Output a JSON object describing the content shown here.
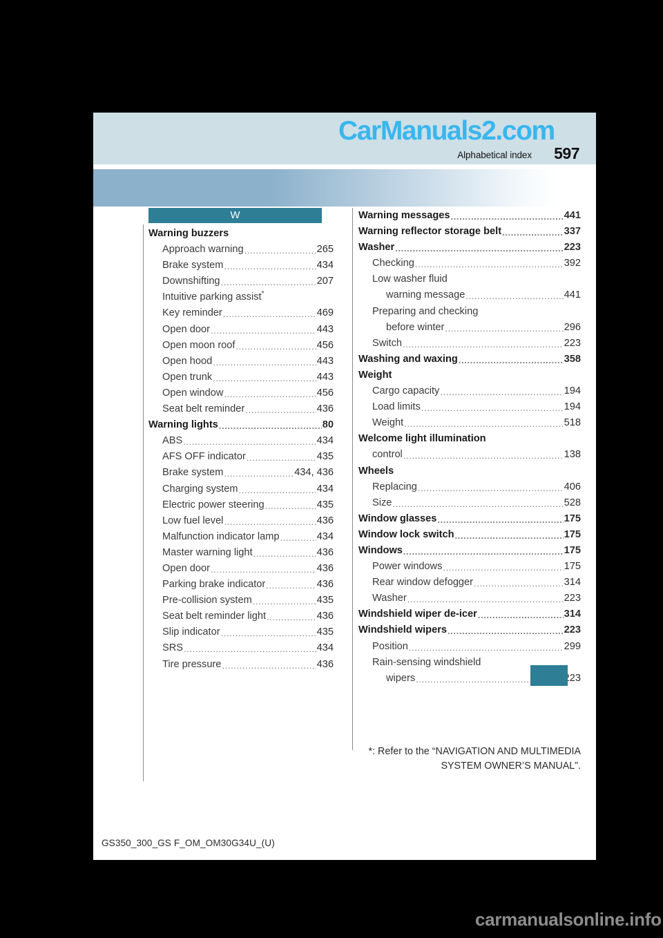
{
  "header": {
    "title": "Alphabetical index",
    "page_number": "597",
    "watermark": "CarManuals2.com"
  },
  "letter_section": "W",
  "left_column": [
    {
      "label": "Warning buzzers",
      "page": "",
      "level": 0,
      "leader": false
    },
    {
      "label": "Approach warning",
      "page": "265",
      "level": 1,
      "leader": true
    },
    {
      "label": "Brake system",
      "page": "434",
      "level": 1,
      "leader": true
    },
    {
      "label": "Downshifting",
      "page": "207",
      "level": 1,
      "leader": true
    },
    {
      "label": "Intuitive parking assist",
      "page": "",
      "level": 1,
      "leader": false,
      "superscript": "*"
    },
    {
      "label": "Key reminder",
      "page": "469",
      "level": 1,
      "leader": true
    },
    {
      "label": "Open door",
      "page": "443",
      "level": 1,
      "leader": true
    },
    {
      "label": "Open moon roof",
      "page": "456",
      "level": 1,
      "leader": true
    },
    {
      "label": "Open hood",
      "page": "443",
      "level": 1,
      "leader": true
    },
    {
      "label": "Open trunk",
      "page": "443",
      "level": 1,
      "leader": true
    },
    {
      "label": "Open window",
      "page": "456",
      "level": 1,
      "leader": true
    },
    {
      "label": "Seat belt reminder",
      "page": "436",
      "level": 1,
      "leader": true
    },
    {
      "label": "Warning lights",
      "page": "80",
      "level": 0,
      "leader": true
    },
    {
      "label": "ABS",
      "page": "434",
      "level": 1,
      "leader": true
    },
    {
      "label": "AFS OFF indicator",
      "page": "435",
      "level": 1,
      "leader": true
    },
    {
      "label": "Brake system",
      "page": "434, 436",
      "level": 1,
      "leader": true
    },
    {
      "label": "Charging system",
      "page": "434",
      "level": 1,
      "leader": true
    },
    {
      "label": "Electric power steering",
      "page": "435",
      "level": 1,
      "leader": true
    },
    {
      "label": "Low fuel level",
      "page": "436",
      "level": 1,
      "leader": true
    },
    {
      "label": "Malfunction indicator lamp",
      "page": "434",
      "level": 1,
      "leader": true
    },
    {
      "label": "Master warning light",
      "page": "436",
      "level": 1,
      "leader": true
    },
    {
      "label": "Open door",
      "page": "436",
      "level": 1,
      "leader": true
    },
    {
      "label": "Parking brake indicator",
      "page": "436",
      "level": 1,
      "leader": true
    },
    {
      "label": "Pre-collision system",
      "page": "435",
      "level": 1,
      "leader": true
    },
    {
      "label": "Seat belt reminder light",
      "page": "436",
      "level": 1,
      "leader": true
    },
    {
      "label": "Slip indicator",
      "page": "435",
      "level": 1,
      "leader": true
    },
    {
      "label": "SRS",
      "page": "434",
      "level": 1,
      "leader": true
    },
    {
      "label": "Tire pressure",
      "page": "436",
      "level": 1,
      "leader": true
    }
  ],
  "right_column": [
    {
      "label": "Warning messages",
      "page": "441",
      "level": 0,
      "leader": true
    },
    {
      "label": "Warning reflector storage belt",
      "page": "337",
      "level": 0,
      "leader": true
    },
    {
      "label": "Washer",
      "page": "223",
      "level": 0,
      "leader": true
    },
    {
      "label": "Checking",
      "page": "392",
      "level": 1,
      "leader": true
    },
    {
      "label": "Low washer fluid",
      "page": "",
      "level": 1,
      "leader": false
    },
    {
      "label": "warning message",
      "page": "441",
      "level": 2,
      "leader": true
    },
    {
      "label": "Preparing and checking",
      "page": "",
      "level": 1,
      "leader": false
    },
    {
      "label": "before winter",
      "page": "296",
      "level": 2,
      "leader": true
    },
    {
      "label": "Switch",
      "page": "223",
      "level": 1,
      "leader": true
    },
    {
      "label": "Washing and waxing",
      "page": "358",
      "level": 0,
      "leader": true
    },
    {
      "label": "Weight",
      "page": "",
      "level": 0,
      "leader": false
    },
    {
      "label": "Cargo capacity",
      "page": "194",
      "level": 1,
      "leader": true
    },
    {
      "label": "Load limits",
      "page": "194",
      "level": 1,
      "leader": true
    },
    {
      "label": "Weight",
      "page": "518",
      "level": 1,
      "leader": true
    },
    {
      "label": "Welcome light illumination",
      "page": "",
      "level": 0,
      "leader": false
    },
    {
      "label": "control",
      "page": "138",
      "level": 1,
      "leader": true
    },
    {
      "label": "Wheels",
      "page": "",
      "level": 0,
      "leader": false
    },
    {
      "label": "Replacing",
      "page": "406",
      "level": 1,
      "leader": true
    },
    {
      "label": "Size",
      "page": "528",
      "level": 1,
      "leader": true
    },
    {
      "label": "Window glasses",
      "page": "175",
      "level": 0,
      "leader": true
    },
    {
      "label": "Window lock switch",
      "page": "175",
      "level": 0,
      "leader": true
    },
    {
      "label": "Windows",
      "page": "175",
      "level": 0,
      "leader": true
    },
    {
      "label": "Power windows",
      "page": "175",
      "level": 1,
      "leader": true
    },
    {
      "label": "Rear window defogger",
      "page": "314",
      "level": 1,
      "leader": true
    },
    {
      "label": "Washer",
      "page": "223",
      "level": 1,
      "leader": true
    },
    {
      "label": "Windshield wiper de-icer",
      "page": "314",
      "level": 0,
      "leader": true
    },
    {
      "label": "Windshield wipers",
      "page": "223",
      "level": 0,
      "leader": true
    },
    {
      "label": "Position",
      "page": "299",
      "level": 1,
      "leader": true
    },
    {
      "label": "Rain-sensing windshield",
      "page": "",
      "level": 1,
      "leader": false
    },
    {
      "label": "wipers",
      "page": "223",
      "level": 2,
      "leader": true
    }
  ],
  "footnote": {
    "line1": "*: Refer to the “NAVIGATION AND MULTIMEDIA",
    "line2": "SYSTEM OWNER’S MANUAL”."
  },
  "document_code": "GS350_300_GS F_OM_OM30G34U_(U)",
  "bottom_watermark": "carmanualsonline.info",
  "colors": {
    "header_band": "#cedfe6",
    "gradient_start": "#8cb1cb",
    "accent_teal": "#2e7e96",
    "watermark_blue": "#39b6ef",
    "rule_gray": "#8a8a8a"
  }
}
